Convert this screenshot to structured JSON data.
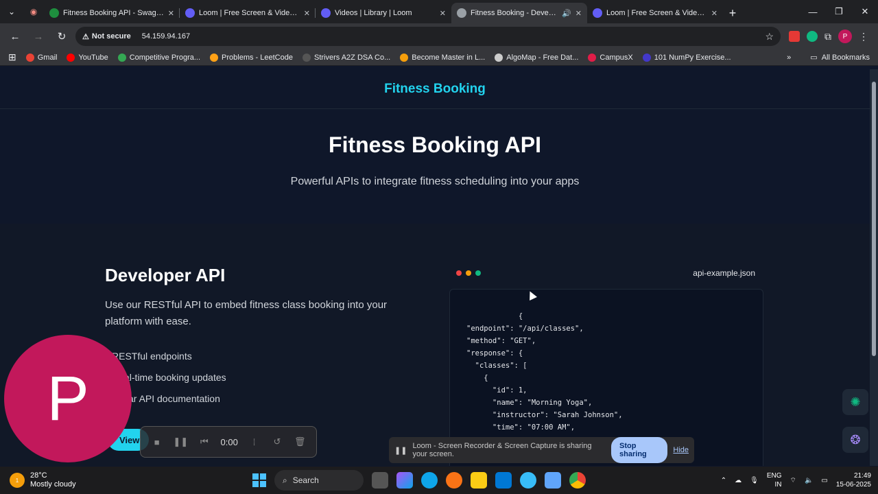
{
  "browser": {
    "tabs": [
      {
        "title": "Fitness Booking API - Swagger",
        "color": "#1e8e3e",
        "active": false
      },
      {
        "title": "Loom | Free Screen & Video Re",
        "color": "#625df5",
        "active": false
      },
      {
        "title": "Videos | Library | Loom",
        "color": "#625df5",
        "active": false
      },
      {
        "title": "Fitness Booking - Develope",
        "color": "#9aa0a6",
        "active": true
      },
      {
        "title": "Loom | Free Screen & Video Re",
        "color": "#625df5",
        "active": false
      }
    ],
    "address": {
      "security_label": "Not secure",
      "url": "54.159.94.167"
    },
    "bookmarks": [
      {
        "label": "Gmail",
        "color": "#ea4335"
      },
      {
        "label": "YouTube",
        "color": "#ff0000"
      },
      {
        "label": "Competitive Progra...",
        "color": "#34a853"
      },
      {
        "label": "Problems - LeetCode",
        "color": "#ffa116"
      },
      {
        "label": "Strivers A2Z DSA Co...",
        "color": "#111111"
      },
      {
        "label": "Become Master in L...",
        "color": "#f59e0b"
      },
      {
        "label": "AlgoMap - Free Dat...",
        "color": "#cccccc"
      },
      {
        "label": "CampusX",
        "color": "#e11d48"
      },
      {
        "label": "101 NumPy Exercise...",
        "color": "#4338ca"
      }
    ],
    "all_bookmarks_label": "All Bookmarks",
    "profile_initial": "P"
  },
  "site": {
    "brand": "Fitness Booking",
    "hero_title": "Fitness Booking API",
    "hero_subtitle": "Powerful APIs to integrate fitness scheduling into your apps",
    "developer": {
      "heading": "Developer API",
      "description": "Use our RESTful API to embed fitness class booking into your platform with ease.",
      "features": [
        "RESTful endpoints",
        "al-time booking updates",
        "ar API documentation"
      ],
      "view_button": "View"
    },
    "code_sample": {
      "filename": "api-example.json",
      "text": "            {\n\"endpoint\": \"/api/classes\",\n\"method\": \"GET\",\n\"response\": {\n  \"classes\": [\n    {\n      \"id\": 1,\n      \"name\": \"Morning Yoga\",\n      \"instructor\": \"Sarah Johnson\",\n      \"time\": \"07:00 AM\","
    }
  },
  "loom": {
    "avatar_initial": "P",
    "timer": "0:00",
    "share_message": "Loom - Screen Recorder & Screen Capture is sharing your screen.",
    "stop_label": "Stop sharing",
    "hide_label": "Hide"
  },
  "taskbar": {
    "temperature": "28°C",
    "weather": "Mostly cloudy",
    "weather_badge": "1",
    "search_label": "Search",
    "language": "ENG",
    "region": "IN",
    "time": "21:49",
    "date": "15-06-2025"
  }
}
